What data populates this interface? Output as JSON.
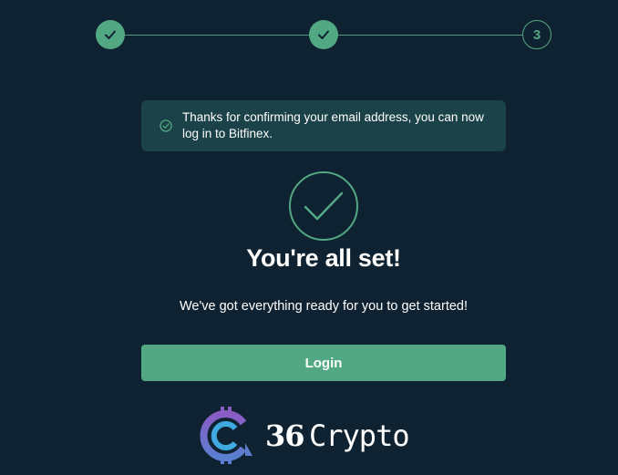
{
  "stepper": {
    "steps": [
      {
        "state": "done",
        "icon": "check-icon"
      },
      {
        "state": "done",
        "icon": "check-icon"
      },
      {
        "state": "current",
        "number": "3"
      }
    ]
  },
  "alert": {
    "icon": "check-circle-icon",
    "message": "Thanks for confirming your email address, you can now log in to Bitfinex."
  },
  "main": {
    "icon": "big-check-circle-icon",
    "headline": "You're all set!",
    "subtext": "We've got everything ready for you to get started!",
    "login_label": "Login"
  },
  "watermark": {
    "number": "36",
    "word": "Crypto"
  },
  "colors": {
    "background": "#0f2231",
    "accent": "#52a882",
    "alert_bg": "#1b4249"
  }
}
